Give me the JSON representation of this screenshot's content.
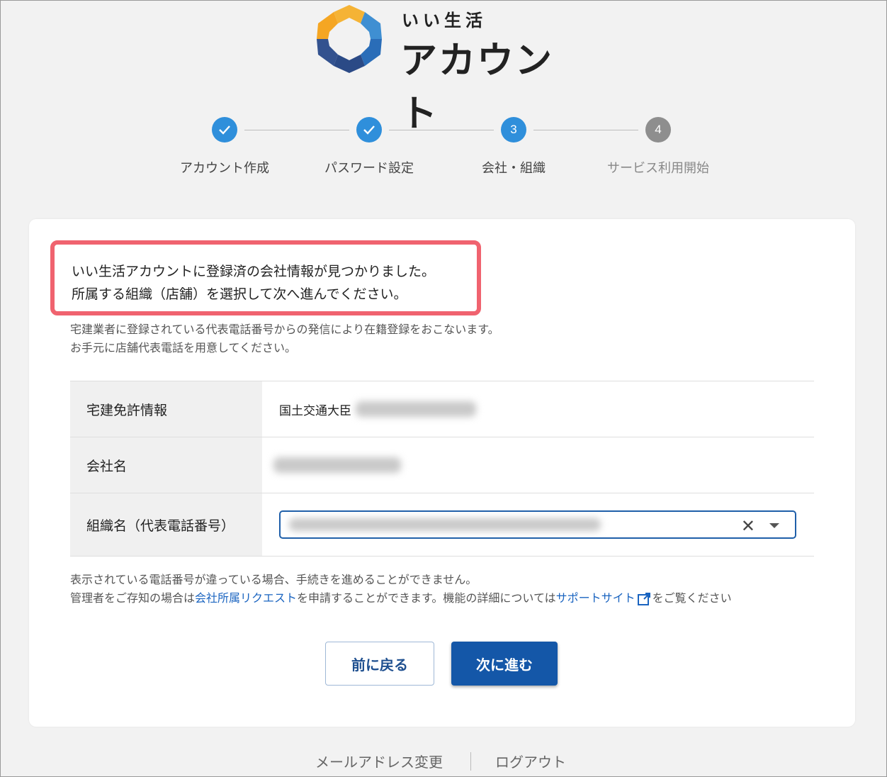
{
  "logo": {
    "subtitle": "いい生活",
    "title": "アカウント"
  },
  "stepper": [
    {
      "label": "アカウント作成",
      "number": "",
      "state": "done"
    },
    {
      "label": "パスワード設定",
      "number": "",
      "state": "done"
    },
    {
      "label": "会社・組織",
      "number": "3",
      "state": "current"
    },
    {
      "label": "サービス利用開始",
      "number": "4",
      "state": "todo"
    }
  ],
  "message": {
    "line1": "いい生活アカウントに登録済の会社情報が見つかりました。",
    "line2": "所属する組織（店舗）を選択して次へ進んでください。"
  },
  "note": {
    "line1": "宅建業者に登録されている代表電話番号からの発信により在籍登録をおこないます。",
    "line2": "お手元に店舗代表電話を用意してください。"
  },
  "table": {
    "license_label": "宅建免許情報",
    "license_value": "国土交通大臣",
    "company_label": "会社名",
    "org_label": "組織名（代表電話番号）"
  },
  "footnote": {
    "line1": "表示されている電話番号が違っている場合、手続きを進めることができません。",
    "line2_a": "管理者をご存知の場合は",
    "link1": "会社所属リクエスト",
    "line2_b": "を申請することができます。機能の詳細については",
    "link2": "サポートサイト",
    "line2_c": "をご覧ください"
  },
  "buttons": {
    "back": "前に戻る",
    "next": "次に進む"
  },
  "bottom": {
    "email_change": "メールアドレス変更",
    "logout": "ログアウト"
  },
  "colors": {
    "accent": "#2f8fdb",
    "primary_button": "#1457a8",
    "highlight_border": "#f0636f",
    "link": "#1a64c0"
  }
}
